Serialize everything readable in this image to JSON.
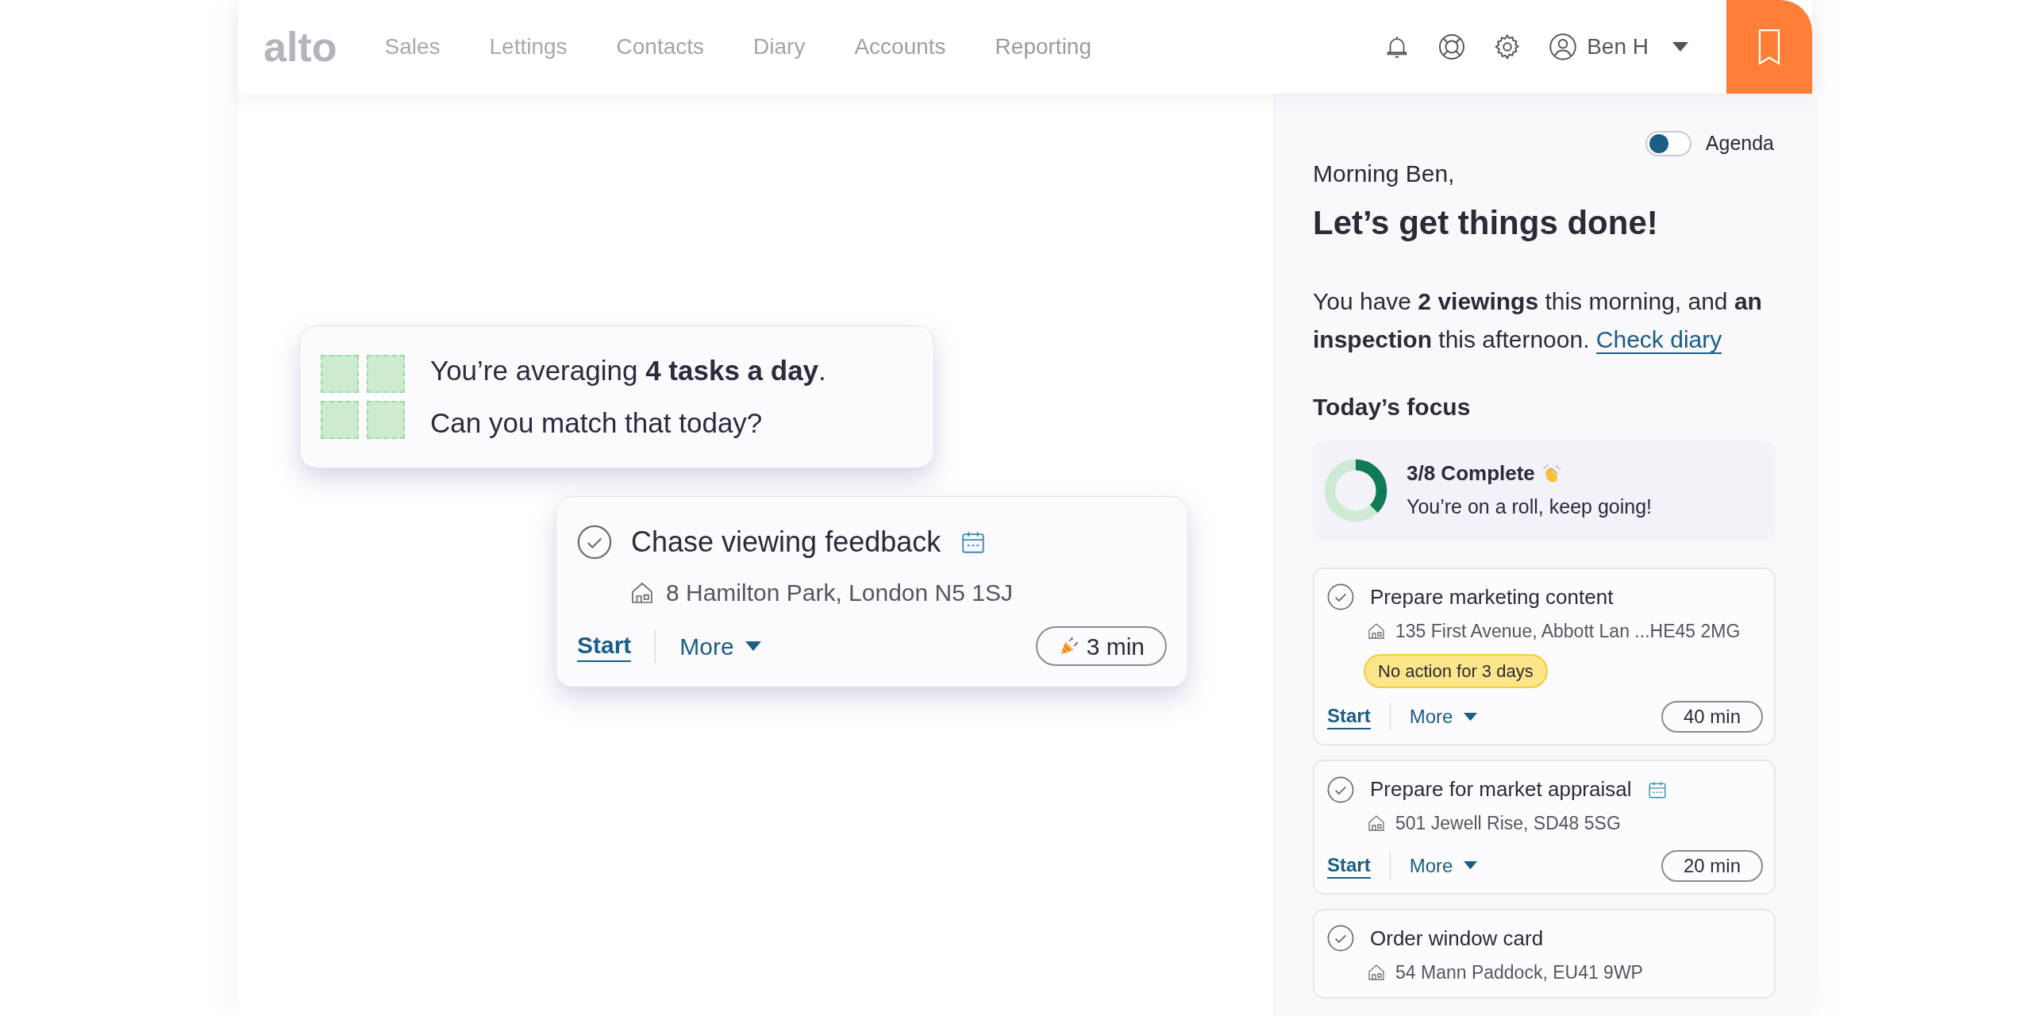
{
  "nav": {
    "logo": "alto",
    "items": [
      {
        "label": "Sales"
      },
      {
        "label": "Lettings"
      },
      {
        "label": "Contacts"
      },
      {
        "label": "Diary"
      },
      {
        "label": "Accounts"
      },
      {
        "label": "Reporting"
      }
    ],
    "user": "Ben H"
  },
  "promo_card": {
    "lines": [
      "You’re averaging **4 tasks a day**.",
      "Can you match that today?"
    ]
  },
  "featured_task": {
    "title": "Chase viewing feedback",
    "scheduled": true,
    "address": "8 Hamilton Park, London N5 1SJ",
    "start": "Start",
    "more": "More",
    "duration": "3 min",
    "celebrate": true
  },
  "panel": {
    "agenda_toggle": {
      "label": "Agenda",
      "on": false
    },
    "greeting": "Morning Ben,",
    "heading": "Let’s get things done!",
    "summary": "You have **2 viewings** this morning, and **an inspection** this afternoon.",
    "summary_link": "Check diary",
    "focus_title": "Today’s focus",
    "progress": {
      "title": "3/8 Complete",
      "level": 0.375,
      "subtitle": "You’re on a roll, keep going!"
    },
    "tasks": [
      {
        "title": "Prepare marketing content",
        "scheduled": false,
        "address": "135 First Avenue, Abbott Lan ...HE45 2MG",
        "badge": "No action for 3 days",
        "start": "Start",
        "more": "More",
        "duration": "40 min"
      },
      {
        "title": "Prepare for market appraisal",
        "scheduled": true,
        "address": "501 Jewell Rise, SD48 5SG",
        "start": "Start",
        "more": "More",
        "duration": "20 min"
      },
      {
        "title": "Order window card",
        "scheduled": false,
        "address": "54 Mann Paddock, EU41 9WP"
      }
    ]
  }
}
